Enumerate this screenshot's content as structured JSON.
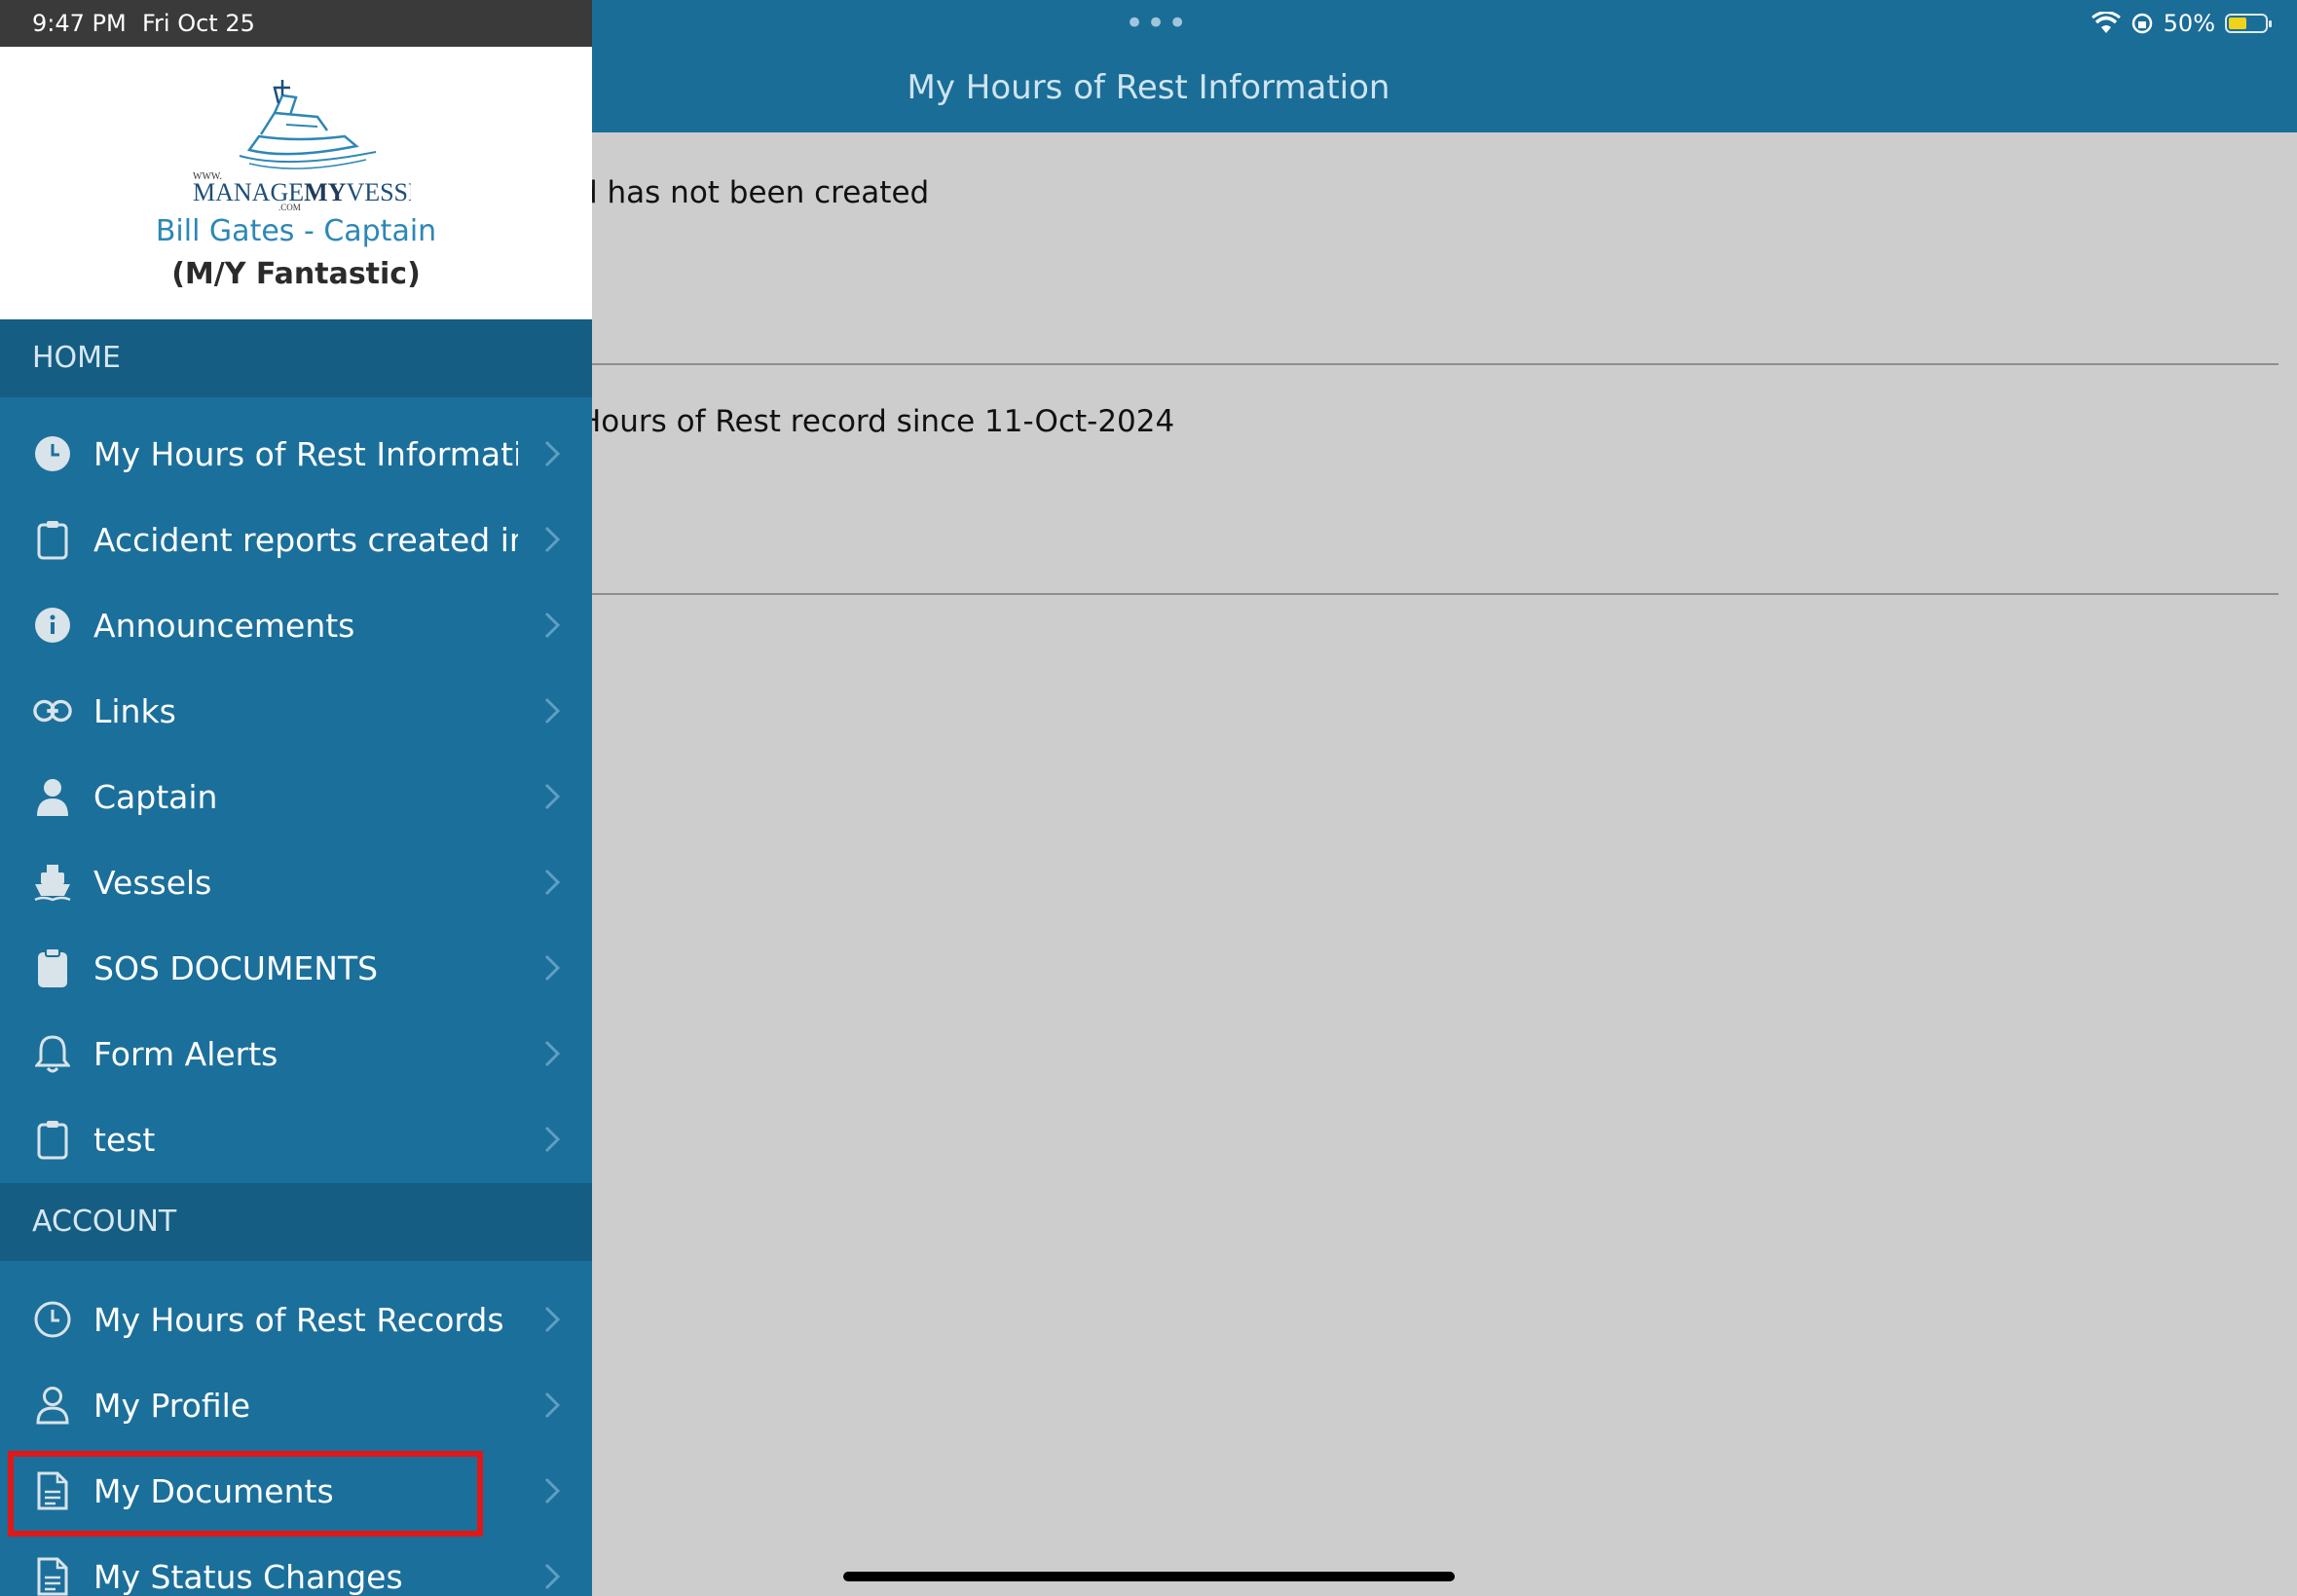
{
  "status_bar": {
    "time": "9:47 PM",
    "date": "Fri Oct 25",
    "battery": "50%",
    "battery_level": 0.5
  },
  "header": {
    "title": "My Hours of Rest Information"
  },
  "content": {
    "messages": [
      "d has not been created",
      "Hours of Rest record since 11-Oct-2024"
    ]
  },
  "profile": {
    "logo_text_www": "WWW.",
    "logo_text_manage": "MANAGE",
    "logo_text_my": "MY",
    "logo_text_vessel": "VESSEL",
    "logo_text_com": ".COM",
    "user_name": "Bill Gates - Captain",
    "vessel": "(M/Y Fantastic)"
  },
  "sidebar": {
    "home_header": "HOME",
    "home_items": [
      {
        "label": "My Hours of Rest Information",
        "icon": "clock-filled-icon"
      },
      {
        "label": "Accident reports created in th",
        "icon": "clipboard-outline-icon"
      },
      {
        "label": "Announcements",
        "icon": "info-icon"
      },
      {
        "label": "Links",
        "icon": "link-icon"
      },
      {
        "label": "Captain",
        "icon": "person-filled-icon"
      },
      {
        "label": "Vessels",
        "icon": "ship-icon"
      },
      {
        "label": "SOS DOCUMENTS",
        "icon": "clipboard-filled-icon"
      },
      {
        "label": "Form Alerts",
        "icon": "bell-icon"
      },
      {
        "label": "test",
        "icon": "clipboard-outline-icon"
      }
    ],
    "account_header": "ACCOUNT",
    "account_items": [
      {
        "label": "My Hours of Rest Records",
        "icon": "clock-outline-icon"
      },
      {
        "label": "My Profile",
        "icon": "person-outline-icon"
      },
      {
        "label": "My Documents",
        "icon": "document-icon"
      },
      {
        "label": "My Status Changes",
        "icon": "document-icon"
      }
    ]
  },
  "colors": {
    "drawer": "#1b6f9b",
    "section_header": "#155d82",
    "highlight": "#e01818",
    "accent_text": "#2d87b6"
  }
}
